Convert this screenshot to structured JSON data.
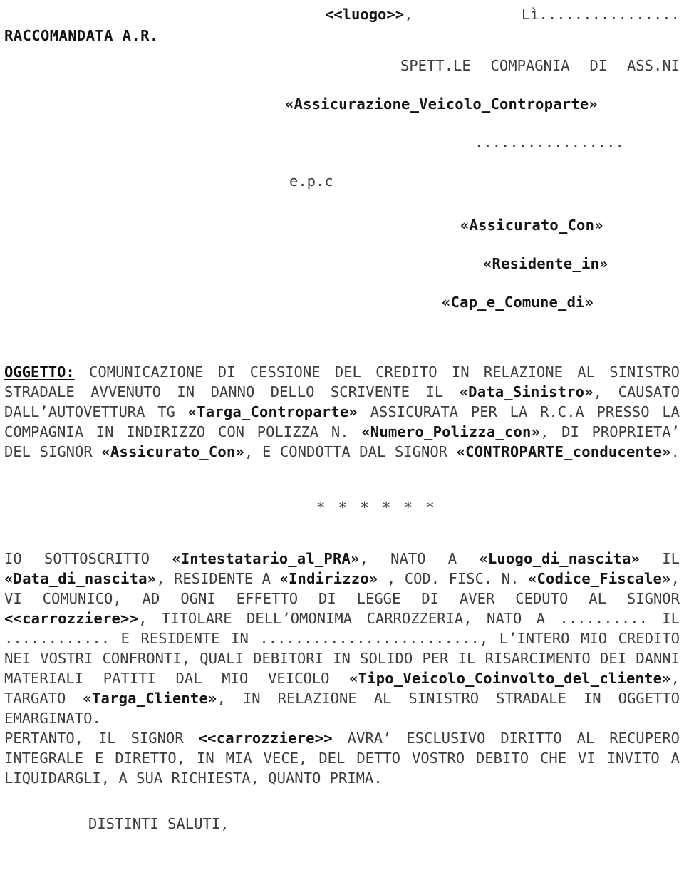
{
  "document": {
    "type": "letter",
    "language": "it",
    "header": {
      "place_date_line": {
        "place_field": "<<luogo>>",
        "separator": ", ",
        "date_label": "Lì",
        "date_dots": "................"
      },
      "registered_mail_label": "RACCOMANDATA A.R.",
      "recipient_label": "SPETT.LE COMPAGNIA DI ASS.NI",
      "recipient_company_field": "«Assicurazione_Veicolo_Controparte»",
      "recipient_address_dots": ".................",
      "cc_label": "e.p.c",
      "cc_name_field": "«Assicurato_Con»",
      "cc_residence_field": "«Residente_in»",
      "cc_cap_comune_field": "«Cap_e_Comune_di»"
    },
    "subject": {
      "label": "OGGETTO:",
      "segments": [
        {
          "text": " COMUNICAZIONE DI CESSIONE DEL CREDITO IN RELAZIONE AL SINISTRO STRADALE AVVENUTO IN DANNO DELLO SCRIVENTE IL ",
          "bold": false
        },
        {
          "text": "«Data_Sinistro»",
          "bold": true
        },
        {
          "text": ", CAUSATO DALL’AUTOVETTURA TG ",
          "bold": false
        },
        {
          "text": "«Targa_Controparte»",
          "bold": true
        },
        {
          "text": " ASSICURATA PER LA R.C.A PRESSO LA COMPAGNIA IN INDIRIZZO CON POLIZZA N. ",
          "bold": false
        },
        {
          "text": "«Numero_Polizza_con»",
          "bold": true
        },
        {
          "text": ", DI PROPRIETA’ DEL SIGNOR ",
          "bold": false
        },
        {
          "text": "«Assicurato_Con»",
          "bold": true
        },
        {
          "text": ", E CONDOTTA DAL SIGNOR ",
          "bold": false
        },
        {
          "text": "«CONTROPARTE_conducente»",
          "bold": true
        },
        {
          "text": ".",
          "bold": false
        }
      ]
    },
    "separator": "* * * * * *",
    "body": {
      "paragraph_1_segments": [
        {
          "text": "IO SOTTOSCRITTO ",
          "bold": false
        },
        {
          "text": "«Intestatario_al_PRA»",
          "bold": true
        },
        {
          "text": ", NATO A ",
          "bold": false
        },
        {
          "text": "«Luogo_di_nascita»",
          "bold": true
        },
        {
          "text": " IL ",
          "bold": false
        },
        {
          "text": "«Data_di_nascita»",
          "bold": true
        },
        {
          "text": ", RESIDENTE A ",
          "bold": false
        },
        {
          "text": "«Indirizzo»",
          "bold": true
        },
        {
          "text": " , COD. FISC. N. ",
          "bold": false
        },
        {
          "text": "«Codice_Fiscale»",
          "bold": true
        },
        {
          "text": ", VI COMUNICO, AD OGNI EFFETTO DI LEGGE DI AVER CEDUTO AL SIGNOR ",
          "bold": false
        },
        {
          "text": "<<carrozziere>>",
          "bold": true
        },
        {
          "text": ", TITOLARE DELL’OMONIMA CARROZZERIA, NATO A .......... IL ............ E RESIDENTE IN ........................., L’INTERO MIO CREDITO NEI VOSTRI CONFRONTI, QUALI DEBITORI IN SOLIDO PER IL RISARCIMENTO DEI DANNI MATERIALI PATITI DAL MIO VEICOLO ",
          "bold": false
        },
        {
          "text": "«Tipo_Veicolo_Coinvolto_del_cliente»",
          "bold": true
        },
        {
          "text": ", TARGATO ",
          "bold": false
        },
        {
          "text": "«Targa_Cliente»",
          "bold": true
        },
        {
          "text": ", IN RELAZIONE AL SINISTRO STRADALE IN OGGETTO EMARGINATO.",
          "bold": false
        }
      ],
      "paragraph_2_segments": [
        {
          "text": "PERTANTO, IL SIGNOR ",
          "bold": false
        },
        {
          "text": "<<carrozziere>>",
          "bold": true
        },
        {
          "text": " AVRA’ ESCLUSIVO DIRITTO AL RECUPERO INTEGRALE E DIRETTO, IN MIA VECE, DEL DETTO VOSTRO DEBITO CHE VI INVITO A LIQUIDARGLI, A SUA RICHIESTA, QUANTO PRIMA.",
          "bold": false
        }
      ]
    },
    "closing": "DISTINTI SALUTI,"
  }
}
